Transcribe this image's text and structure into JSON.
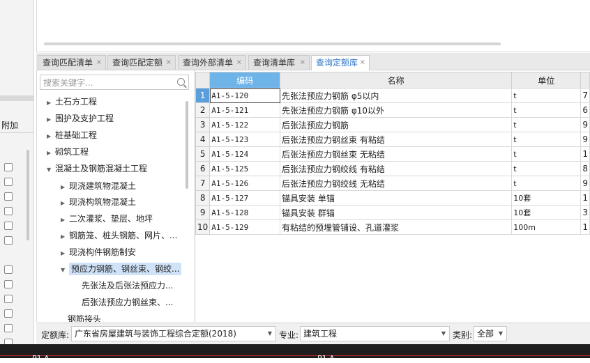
{
  "left_strip": {
    "label": "附加"
  },
  "tabs": [
    {
      "label": "查询匹配清单",
      "active": false
    },
    {
      "label": "查询匹配定额",
      "active": false
    },
    {
      "label": "查询外部清单",
      "active": false
    },
    {
      "label": "查询清单库",
      "active": false
    },
    {
      "label": "查询定额库",
      "active": true
    }
  ],
  "tab_close": "×",
  "search": {
    "placeholder": "搜索关键字..."
  },
  "tree": [
    {
      "label": "土石方工程",
      "arrow": "▶",
      "level": 0
    },
    {
      "label": "围护及支护工程",
      "arrow": "▶",
      "level": 0
    },
    {
      "label": "桩基础工程",
      "arrow": "▶",
      "level": 0
    },
    {
      "label": "砌筑工程",
      "arrow": "▶",
      "level": 0
    },
    {
      "label": "混凝土及钢筋混凝土工程",
      "arrow": "▼",
      "level": 0
    },
    {
      "label": "现浇建筑物混凝土",
      "arrow": "▶",
      "level": 1
    },
    {
      "label": "现浇构筑物混凝土",
      "arrow": "▶",
      "level": 1
    },
    {
      "label": "二次灌浆、垫层、地坪",
      "arrow": "▶",
      "level": 1
    },
    {
      "label": "钢筋笼、桩头钢筋、网片、...",
      "arrow": "▶",
      "level": 1
    },
    {
      "label": "现浇构件钢筋制安",
      "arrow": "▶",
      "level": 1
    },
    {
      "label": "预应力钢筋、钢丝束、钢绞...",
      "arrow": "▼",
      "level": 1,
      "selected": true
    },
    {
      "label": "先张法及后张法预应力...",
      "arrow": "",
      "level": 2
    },
    {
      "label": "后张法预应力钢丝束、...",
      "arrow": "",
      "level": 2
    },
    {
      "label": "钢筋接头",
      "arrow": "",
      "level": 1
    }
  ],
  "grid": {
    "headers": {
      "code": "编码",
      "name": "名称",
      "unit": "单位"
    },
    "rows": [
      {
        "n": "1",
        "code": "A1-5-120",
        "name": "先张法预应力钢筋 φ5以内",
        "unit": "t",
        "extra": "7"
      },
      {
        "n": "2",
        "code": "A1-5-121",
        "name": "先张法预应力钢筋 φ10以外",
        "unit": "t",
        "extra": "6"
      },
      {
        "n": "3",
        "code": "A1-5-122",
        "name": "后张法预应力钢筋",
        "unit": "t",
        "extra": "9"
      },
      {
        "n": "4",
        "code": "A1-5-123",
        "name": "后张法预应力钢丝束 有粘结",
        "unit": "t",
        "extra": "9"
      },
      {
        "n": "5",
        "code": "A1-5-124",
        "name": "后张法预应力钢丝束 无粘结",
        "unit": "t",
        "extra": "1"
      },
      {
        "n": "6",
        "code": "A1-5-125",
        "name": "后张法预应力钢绞线 有粘结",
        "unit": "t",
        "extra": "8"
      },
      {
        "n": "7",
        "code": "A1-5-126",
        "name": "后张法预应力钢绞线 无粘结",
        "unit": "t",
        "extra": "9"
      },
      {
        "n": "8",
        "code": "A1-5-127",
        "name": "锚具安装 单锚",
        "unit": "10套",
        "extra": "1"
      },
      {
        "n": "9",
        "code": "A1-5-128",
        "name": "锚具安装 群锚",
        "unit": "10套",
        "extra": "3"
      },
      {
        "n": "10",
        "code": "A1-5-129",
        "name": "有粘结的预埋管铺设、孔道灌浆",
        "unit": "100m",
        "extra": "1"
      }
    ]
  },
  "bottom": {
    "quota_label": "定额库:",
    "quota_value": "广东省房屋建筑与装饰工程综合定额(2018)",
    "major_label": "专业:",
    "major_value": "建筑工程",
    "type_label": "类别:",
    "type_value": "全部",
    "caret": "▼"
  },
  "status": {
    "left": "P1 A",
    "right": "P1 A"
  },
  "colors": {
    "accent": "#2d76c8",
    "header_blue": "#6fb4e8",
    "selection": "#cfe2f7"
  }
}
